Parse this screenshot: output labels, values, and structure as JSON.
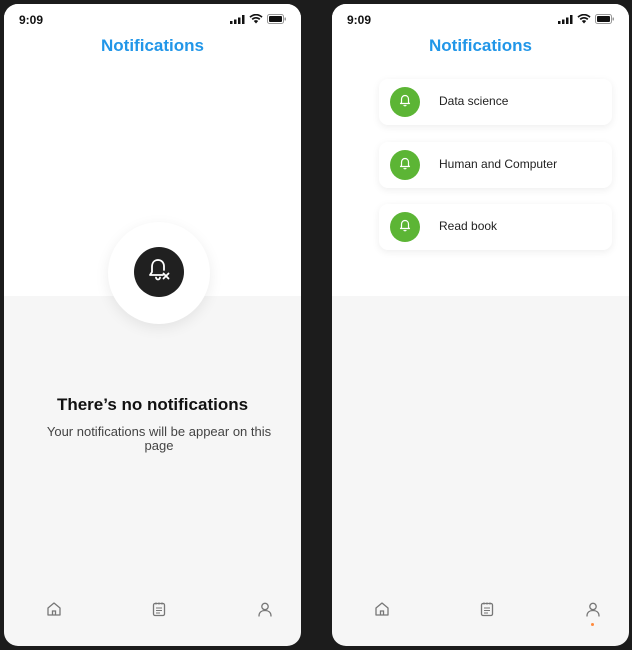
{
  "left_screen": {
    "status": {
      "time": "9:09"
    },
    "title": "Notifications",
    "empty_state": {
      "icon": "bell-off-icon",
      "title": "There’s no notifications",
      "subtitle": "Your notifications will be appear on this page"
    },
    "nav": [
      "home-icon",
      "notes-icon",
      "profile-icon"
    ]
  },
  "right_screen": {
    "status": {
      "time": "9:09"
    },
    "title": "Notifications",
    "items": [
      {
        "label": "Data science",
        "icon": "bell-icon"
      },
      {
        "label": "Human and Computer",
        "icon": "bell-icon"
      },
      {
        "label": "Read book",
        "icon": "bell-icon"
      }
    ],
    "nav": [
      "home-icon",
      "notes-icon",
      "profile-icon"
    ],
    "active_nav": "profile-icon"
  },
  "colors": {
    "accent": "#2196e8",
    "item_icon_bg": "#5cb535",
    "empty_badge_bg": "#202020",
    "active_dot": "#ff8a3d",
    "backdrop": "#1c1c1c"
  }
}
